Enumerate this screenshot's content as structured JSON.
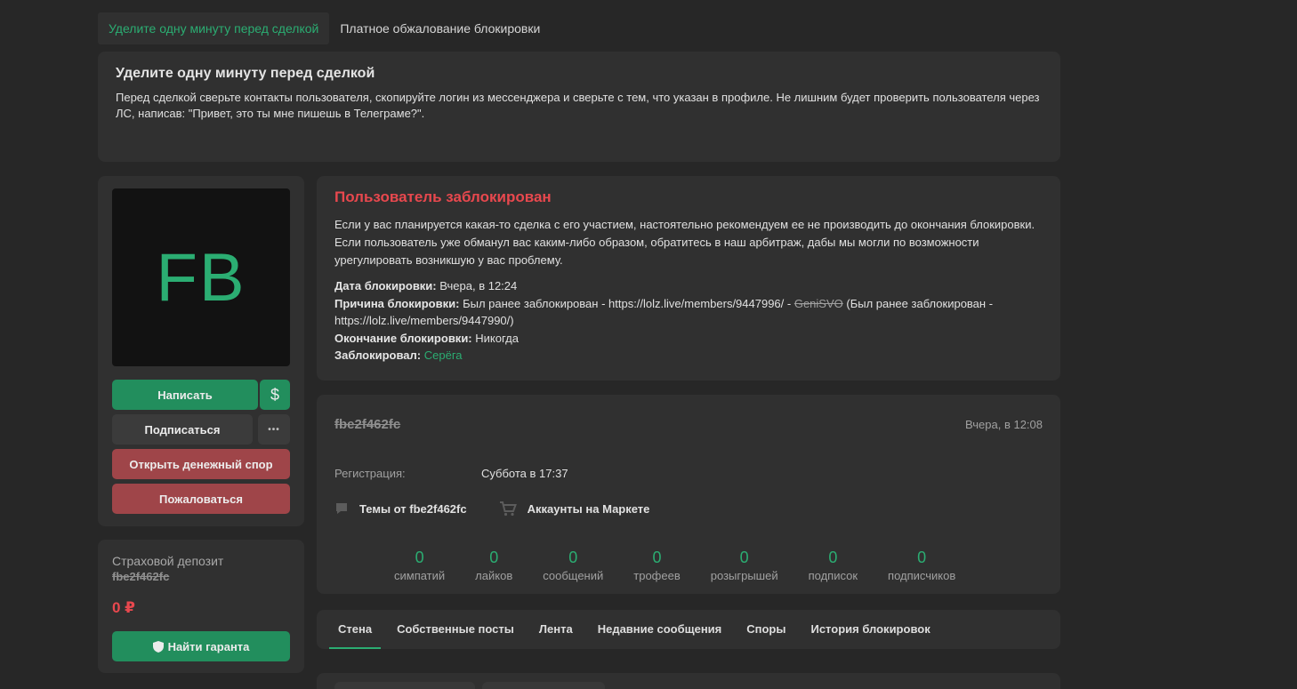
{
  "top_tabs": [
    {
      "label": "Уделите одну минуту перед сделкой",
      "active": true
    },
    {
      "label": "Платное обжалование блокировки",
      "active": false
    }
  ],
  "notice": {
    "title": "Уделите одну минуту перед сделкой",
    "text": "Перед сделкой сверьте контакты пользователя, скопируйте логин из мессенджера и сверьте с тем, что указан в профиле. Не лишним будет проверить пользователя через ЛС, написав: \"Привет, это ты мне пишешь в Телеграме?\"."
  },
  "profile": {
    "avatar_initials": "FB",
    "write_button": "Написать",
    "money_icon_glyph": "$",
    "subscribe_button": "Подписаться",
    "more_glyph": "•••",
    "dispute_button": "Открыть денежный спор",
    "report_button": "Пожаловаться"
  },
  "deposit": {
    "label": "Страховой депозит",
    "username": "fbe2f462fc",
    "amount": "0 ₽",
    "guarantor_button": "Найти гаранта"
  },
  "ban": {
    "title": "Пользователь заблокирован",
    "text": "Если у вас планируется какая-то сделка с его участием, настоятельно рекомендуем ее не производить до окончания блокировки. Если пользователь уже обманул вас каким-либо образом, обратитесь в наш арбитраж, дабы мы могли по возможности урегулировать возникшую у вас проблему.",
    "date_label": "Дата блокировки:",
    "date_value": "Вчера, в 12:24",
    "reason_label": "Причина блокировки:",
    "reason_part1": "Был ранее заблокирован - https://lolz.live/members/9447996/ -",
    "reason_struck": "GeniSVO",
    "reason_part2": "(Был ранее заблокирован - https://lolz.live/members/9447990/)",
    "end_label": "Окончание блокировки:",
    "end_value": "Никогда",
    "by_label": "Заблокировал:",
    "by_value": "Серёга"
  },
  "card": {
    "username": "fbe2f462fc",
    "last_seen": "Вчера, в 12:08",
    "registration_label": "Регистрация:",
    "registration_value": "Суббота в 17:37",
    "threads_link": "Темы от fbe2f462fc",
    "market_link": "Аккаунты на Маркете",
    "stats": [
      {
        "value": "0",
        "label": "симпатий"
      },
      {
        "value": "0",
        "label": "лайков"
      },
      {
        "value": "0",
        "label": "сообщений"
      },
      {
        "value": "0",
        "label": "трофеев"
      },
      {
        "value": "0",
        "label": "розыгрышей"
      },
      {
        "value": "0",
        "label": "подписок"
      },
      {
        "value": "0",
        "label": "подписчиков"
      }
    ]
  },
  "profile_tabs": [
    {
      "label": "Стена",
      "active": true
    },
    {
      "label": "Собственные посты",
      "active": false
    },
    {
      "label": "Лента",
      "active": false
    },
    {
      "label": "Недавние сообщения",
      "active": false
    },
    {
      "label": "Споры",
      "active": false
    },
    {
      "label": "История блокировок",
      "active": false
    }
  ],
  "colors": {
    "accent": "#2bad72",
    "danger": "#e8484e",
    "panel": "#303030",
    "background": "#272727"
  }
}
